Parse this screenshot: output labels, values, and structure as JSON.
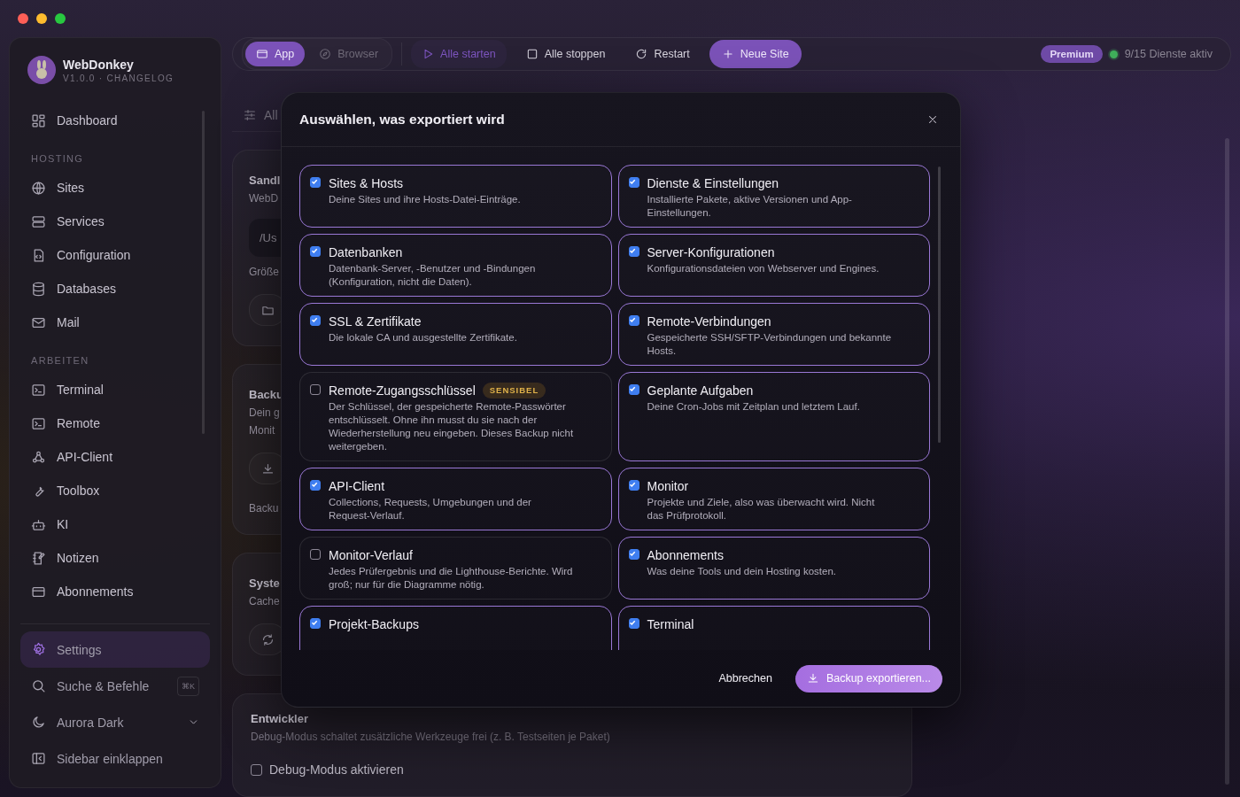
{
  "app": {
    "name": "WebDonkey",
    "version": "V1.0.0 · CHANGELOG"
  },
  "sidebar": {
    "top": [
      {
        "label": "Dashboard",
        "selected": false
      }
    ],
    "sections": [
      {
        "title": "HOSTING",
        "items": [
          {
            "label": "Sites",
            "selected": false
          },
          {
            "label": "Services",
            "selected": false
          },
          {
            "label": "Configuration",
            "selected": false
          },
          {
            "label": "Databases",
            "selected": false
          },
          {
            "label": "Mail",
            "selected": false
          }
        ]
      },
      {
        "title": "ARBEITEN",
        "items": [
          {
            "label": "Terminal",
            "selected": false
          },
          {
            "label": "Remote",
            "selected": false
          },
          {
            "label": "API-Client",
            "selected": false
          },
          {
            "label": "Toolbox",
            "selected": false
          },
          {
            "label": "KI",
            "selected": false
          },
          {
            "label": "Notizen",
            "selected": false
          },
          {
            "label": "Abonnements",
            "selected": false
          }
        ]
      }
    ],
    "settings": {
      "label": "Settings",
      "selected": true
    },
    "search": {
      "label": "Suche & Befehle",
      "shortcut": "⌘K"
    },
    "theme": {
      "label": "Aurora Dark"
    },
    "collapse": {
      "label": "Sidebar einklappen"
    }
  },
  "toolbar": {
    "modes": [
      {
        "label": "App",
        "selected": true
      },
      {
        "label": "Browser",
        "selected": false
      }
    ],
    "actions": [
      {
        "label": "Alle starten",
        "kind": "start"
      },
      {
        "label": "Alle stoppen",
        "kind": "stop"
      },
      {
        "label": "Restart",
        "kind": "restart"
      },
      {
        "label": "Neue Site",
        "kind": "primary"
      }
    ],
    "badge": "Premium",
    "status": "9/15 Dienste aktiv"
  },
  "background": {
    "filter": "All",
    "cards": [
      {
        "title": "Sandl",
        "lines": [
          "WebD"
        ],
        "field": "/Us",
        "note": "Größe",
        "kind": "folder"
      },
      {
        "title": "Backu",
        "lines": [
          "Dein g",
          "Monit"
        ],
        "note": "Backu",
        "kind": "download"
      },
      {
        "title": "Syste",
        "lines": [
          "Cache"
        ],
        "kind": "refresh"
      }
    ],
    "developer": {
      "title": "Entwickler",
      "text": "Debug-Modus schaltet zusätzliche Werkzeuge frei (z. B. Testseiten je Paket)",
      "checkbox": "Debug-Modus aktivieren",
      "checked": false
    }
  },
  "dialog": {
    "title": "Auswählen, was exportiert wird",
    "options": [
      {
        "title": "Sites & Hosts",
        "text": "Deine Sites und ihre Hosts-Datei-Einträge.",
        "checked": true
      },
      {
        "title": "Dienste & Einstellungen",
        "text": "Installierte Pakete, aktive Versionen und App-Einstellungen.",
        "checked": true
      },
      {
        "title": "Datenbanken",
        "text": "Datenbank-Server, -Benutzer und -Bindungen (Konfiguration, nicht die Daten).",
        "checked": true
      },
      {
        "title": "Server-Konfigurationen",
        "text": "Konfigurationsdateien von Webserver und Engines.",
        "checked": true
      },
      {
        "title": "SSL & Zertifikate",
        "text": "Die lokale CA und ausgestellte Zertifikate.",
        "checked": true
      },
      {
        "title": "Remote-Verbindungen",
        "text": "Gespeicherte SSH/SFTP-Verbindungen und bekannte Hosts.",
        "checked": true
      },
      {
        "title": "Remote-Zugangsschlüssel",
        "badge": "SENSIBEL",
        "text": "Der Schlüssel, der gespeicherte Remote-Passwörter entschlüsselt. Ohne ihn musst du sie nach der Wiederherstellung neu eingeben. Dieses Backup nicht weitergeben.",
        "checked": false
      },
      {
        "title": "Geplante Aufgaben",
        "text": "Deine Cron-Jobs mit Zeitplan und letztem Lauf.",
        "checked": true
      },
      {
        "title": "API-Client",
        "text": "Collections, Requests, Umgebungen und der Request-Verlauf.",
        "checked": true
      },
      {
        "title": "Monitor",
        "text": "Projekte und Ziele, also was überwacht wird. Nicht das Prüfprotokoll.",
        "checked": true
      },
      {
        "title": "Monitor-Verlauf",
        "text": "Jedes Prüfergebnis und die Lighthouse-Berichte. Wird groß; nur für die Diagramme nötig.",
        "checked": false
      },
      {
        "title": "Abonnements",
        "text": "Was deine Tools und dein Hosting kosten.",
        "checked": true
      },
      {
        "title": "Projekt-Backups",
        "checked": true
      },
      {
        "title": "Terminal",
        "checked": true
      }
    ],
    "cancel": "Abbrechen",
    "confirm": "Backup exportieren..."
  }
}
